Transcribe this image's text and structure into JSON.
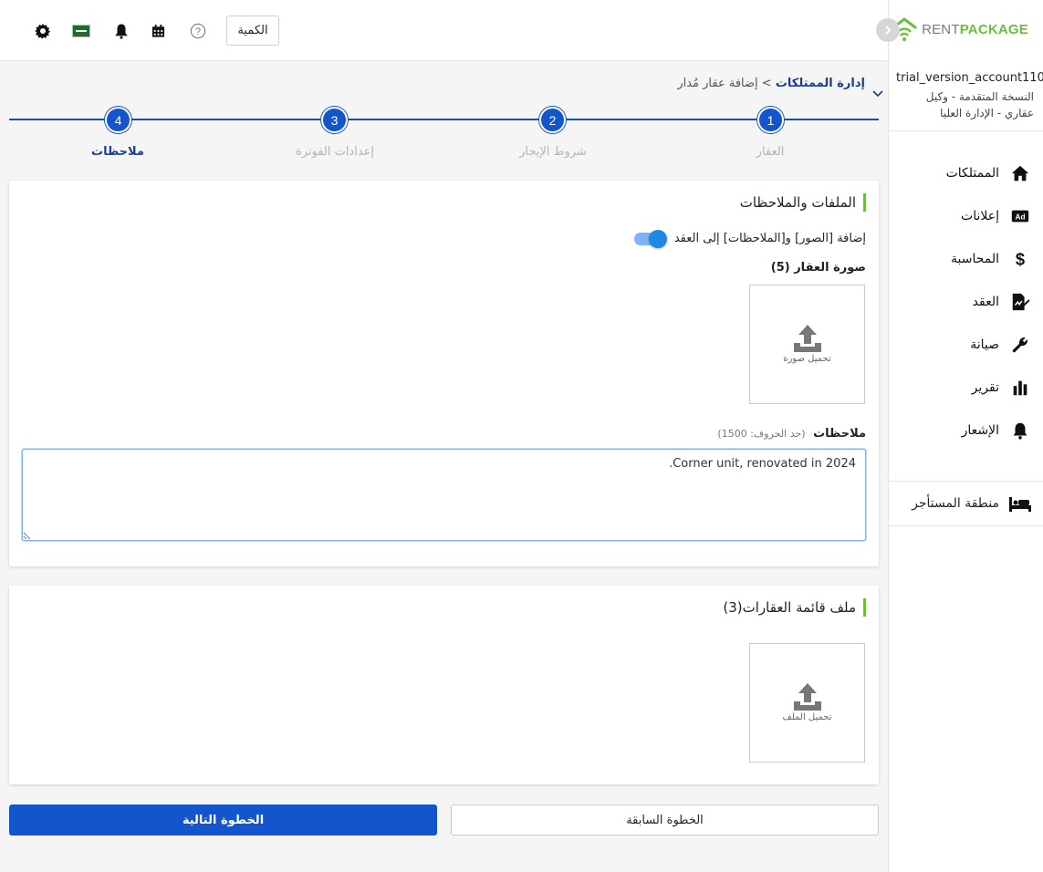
{
  "brand": {
    "rent": "RENT",
    "package": "PACKAGE"
  },
  "account": {
    "name": "trial_version_account110",
    "role": "النسخة المتقدمة - وكيل عقاري - الإدارة العليا"
  },
  "nav": {
    "items": [
      {
        "label": "الممتلكات",
        "icon": "home-icon"
      },
      {
        "label": "إعلانات",
        "icon": "ad-icon"
      },
      {
        "label": "المحاسبة",
        "icon": "dollar-icon"
      },
      {
        "label": "العقد",
        "icon": "contract-icon"
      },
      {
        "label": "صيانة",
        "icon": "wrench-icon"
      },
      {
        "label": "تقرير",
        "icon": "bar-chart-icon"
      },
      {
        "label": "الإشعار",
        "icon": "bell-icon"
      }
    ],
    "tenant": "منطقة المستأجر"
  },
  "topbar": {
    "quantity_label": "الكمية"
  },
  "breadcrumb": {
    "root": "إدارة الممتلكات",
    "separator": ">",
    "current": "إضافة عقار مُدار"
  },
  "steps": [
    {
      "num": "1",
      "label": "العقار"
    },
    {
      "num": "2",
      "label": "شروط الإيجار"
    },
    {
      "num": "3",
      "label": "إعدادات الفوترة"
    },
    {
      "num": "4",
      "label": "ملاحظات"
    }
  ],
  "files_card": {
    "title": "الملفات والملاحظات",
    "toggle_label": "إضافة [الصور] و[الملاحظات] إلى العقد",
    "toggle_on": true,
    "photo_label": "صورة العقار (5)",
    "upload_photo": "تحميل صورة",
    "notes_label": "ملاحظات",
    "notes_limit": "(حد الحروف: 1500)",
    "notes_value": "Corner unit, renovated in 2024."
  },
  "list_card": {
    "title": "ملف قائمة العقارات(3)",
    "upload_file": "تحميل الملف"
  },
  "buttons": {
    "next": "الخطوة التالية",
    "prev": "الخطوة السابقة"
  },
  "colors": {
    "primary": "#1255cc",
    "accent_green": "#6cbf3d",
    "nav_dark": "#1a3e92"
  }
}
